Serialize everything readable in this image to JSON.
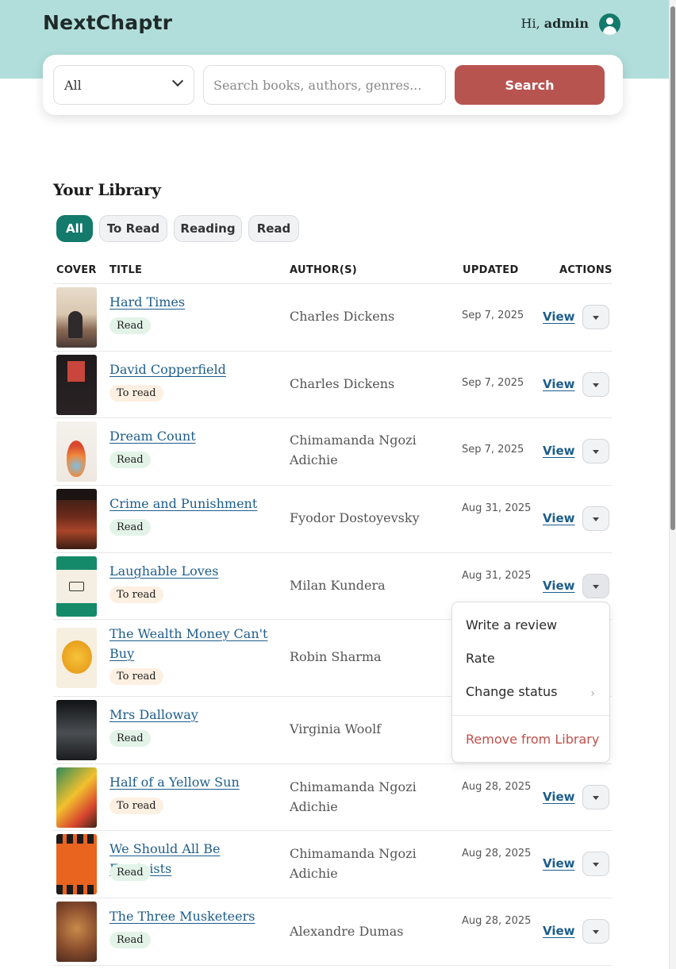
{
  "header": {
    "brand": "NextChaptr",
    "greeting_prefix": "Hi,",
    "username": "admin",
    "user_icon": "user-avatar-icon",
    "band_color": "#b1dedb"
  },
  "search": {
    "category_value": "All",
    "placeholder": "Search books, authors, genres...",
    "button_label": "Search",
    "button_color": "#b85450"
  },
  "library": {
    "title": "Your Library",
    "filters": [
      "All",
      "To Read",
      "Reading",
      "Read"
    ],
    "active_filter": "All",
    "columns": [
      "COVER",
      "TITLE",
      "AUTHOR(S)",
      "UPDATED",
      "ACTIONS"
    ],
    "rows": [
      {
        "title": "Hard Times",
        "status": "Read",
        "author": "Charles Dickens",
        "updated": "Sep 7, 2025",
        "action": "View"
      },
      {
        "title": "David Copperfield",
        "status": "To read",
        "author": "Charles Dickens",
        "updated": "Sep 7, 2025",
        "action": "View"
      },
      {
        "title": "Dream Count",
        "status": "Read",
        "author": "Chimamanda Ngozi Adichie",
        "updated": "Sep 7, 2025",
        "action": "View"
      },
      {
        "title": "Crime and Punishment",
        "status": "Read",
        "author": "Fyodor Dostoyevsky",
        "updated": "Aug 31, 2025",
        "action": "View"
      },
      {
        "title": "Laughable Loves",
        "status": "To read",
        "author": "Milan Kundera",
        "updated": "Aug 31, 2025",
        "action": "View"
      },
      {
        "title": "The Wealth Money Can't Buy",
        "status": "To read",
        "author": "Robin Sharma",
        "updated": "",
        "action": ""
      },
      {
        "title": "Mrs Dalloway",
        "status": "Read",
        "author": "Virginia Woolf",
        "updated": "",
        "action": ""
      },
      {
        "title": "Half of a Yellow Sun",
        "status": "To read",
        "author": "Chimamanda Ngozi Adichie",
        "updated": "Aug 28, 2025",
        "action": "View"
      },
      {
        "title": "We Should All Be Feminists",
        "status": "Read",
        "author": "Chimamanda Ngozi Adichie",
        "updated": "Aug 28, 2025",
        "action": "View"
      },
      {
        "title": "The Three Musketeers",
        "status": "Read",
        "author": "Alexandre Dumas",
        "updated": "Aug 28, 2025",
        "action": "View"
      }
    ]
  },
  "menu": {
    "items": [
      "Write a review",
      "Rate",
      "Change status"
    ],
    "remove_label": "Remove from Library",
    "submenu_arrow": "›"
  },
  "colors": {
    "accent": "#137a6c",
    "link": "#1d5d8c",
    "danger": "#c0504a"
  }
}
